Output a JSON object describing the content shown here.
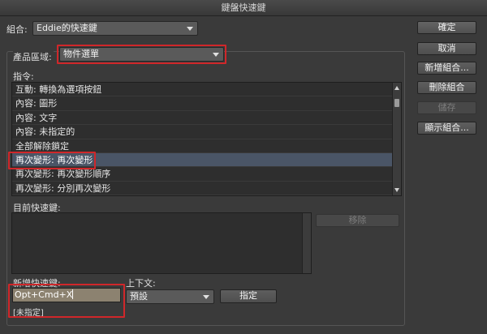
{
  "window": {
    "title": "鍵盤快速鍵"
  },
  "set": {
    "label": "組合:",
    "value": "Eddie的快速鍵"
  },
  "product_area": {
    "label": "產品區域:",
    "value": "物件選單"
  },
  "commands": {
    "label": "指令:",
    "items": [
      "互動: 轉換為選項按鈕",
      "內容: 圖形",
      "內容: 文字",
      "內容: 未指定的",
      "全部解除鎖定",
      "再次變形: 再次變形",
      "再次變形: 再次變形順序",
      "再次變形: 分別再次變形"
    ],
    "selected_index": 5
  },
  "current_shortcuts": {
    "label": "目前快速鍵:"
  },
  "remove_button": {
    "label": "移除"
  },
  "new_shortcut": {
    "label": "新增快速鍵:",
    "value": "Opt+Cmd+X",
    "status": "[未指定]"
  },
  "context": {
    "label": "上下文:",
    "value": "預設"
  },
  "assign_button": {
    "label": "指定"
  },
  "side_buttons": {
    "ok": "確定",
    "cancel": "取消",
    "new_set": "新增組合...",
    "delete_set": "刪除組合",
    "save": "儲存",
    "show_set": "顯示組合..."
  },
  "colors": {
    "highlight": "#d0272a",
    "selection": "#4a5566",
    "input_bg": "#8c8270"
  }
}
